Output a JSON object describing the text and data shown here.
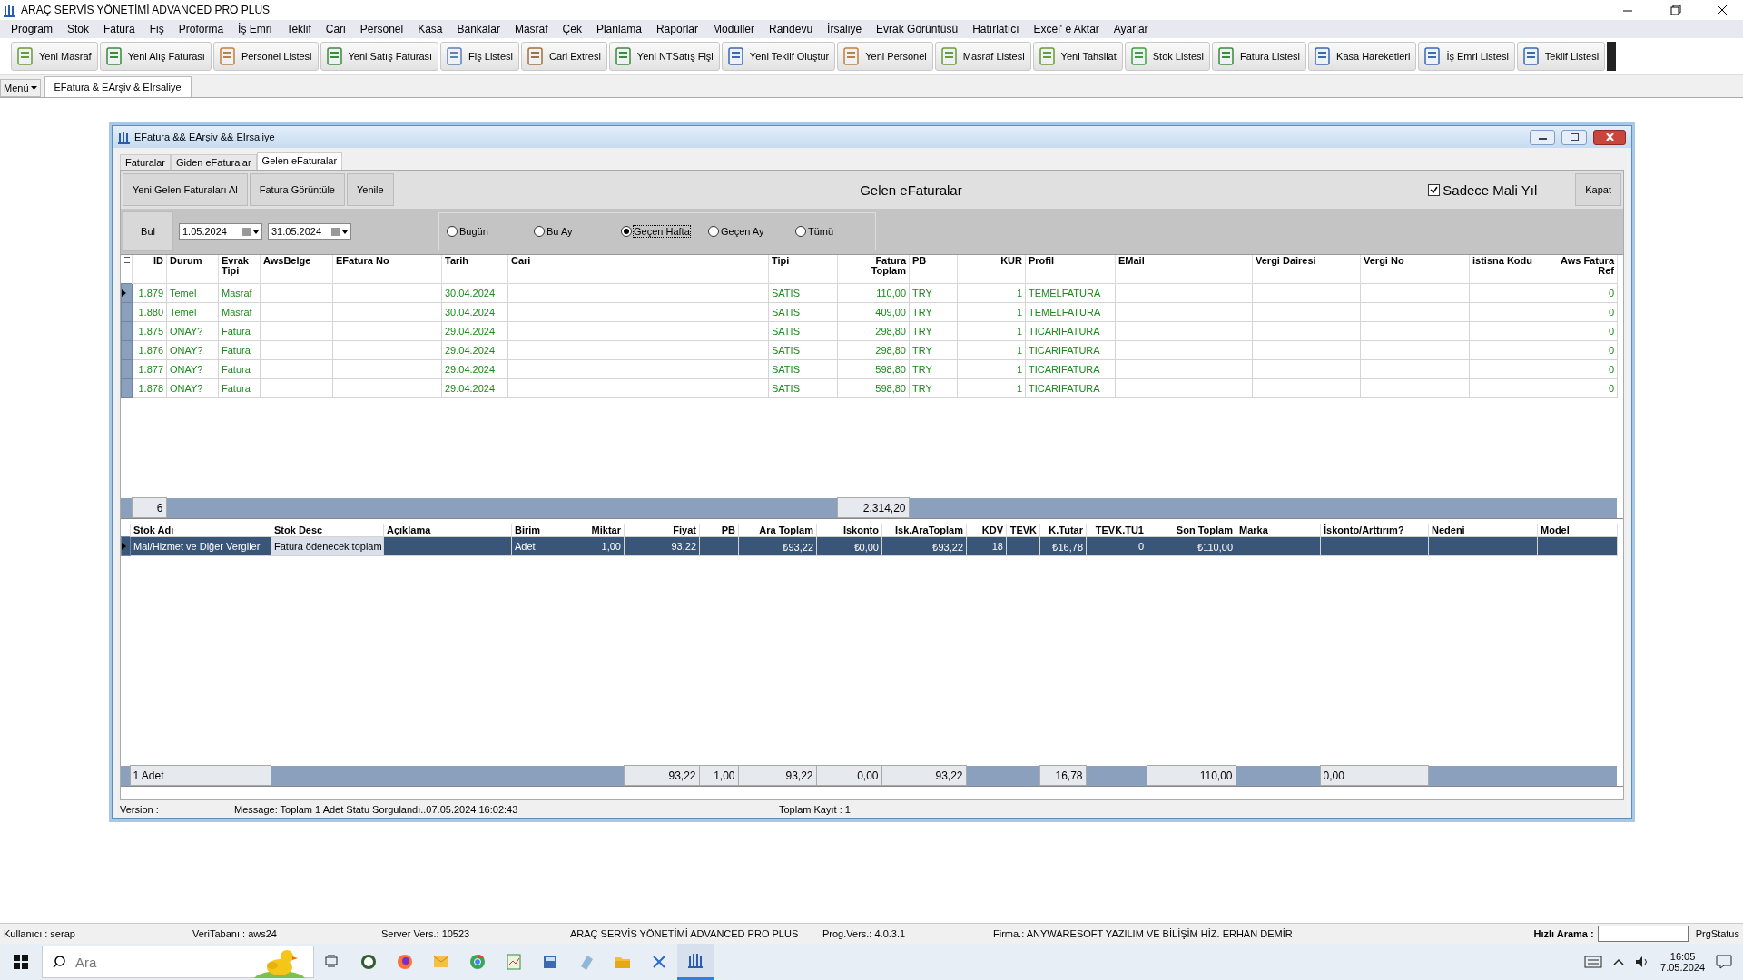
{
  "window": {
    "title": "ARAÇ SERVİS YÖNETİMİ ADVANCED PRO PLUS"
  },
  "menu": [
    "Program",
    "Stok",
    "Fatura",
    "Fiş",
    "Proforma",
    "İş Emri",
    "Teklif",
    "Cari",
    "Personel",
    "Kasa",
    "Bankalar",
    "Masraf",
    "Çek",
    "Planlama",
    "Raporlar",
    "Modüller",
    "Randevu",
    "İrsaliye",
    "Evrak Görüntüsü",
    "Hatırlatıcı",
    "Excel' e Aktar",
    "Ayarlar"
  ],
  "toolbar": [
    "Yeni Masraf",
    "Yeni Alış Faturası",
    "Personel Listesi",
    "Yeni Satış Faturası",
    "Fiş Listesi",
    "Cari Extresi",
    "Yeni NTSatış Fişi",
    "Yeni Teklif Oluştur",
    "Yeni Personel",
    "Masraf Listesi",
    "Yeni Tahsilat",
    "Stok Listesi",
    "Fatura Listesi",
    "Kasa Hareketleri",
    "İş Emri Listesi",
    "Teklif Listesi"
  ],
  "doc_tabs": {
    "menu_button": "Menü",
    "tabs": [
      {
        "label": "EFatura & EArşiv & EIrsaliye",
        "selected": true
      }
    ]
  },
  "child_window": {
    "title": "EFatura &&  EArşiv &&  EIrsaliye",
    "tabs": [
      {
        "label": "Faturalar",
        "selected": false
      },
      {
        "label": "Giden eFaturalar",
        "selected": false
      },
      {
        "label": "Gelen eFaturalar",
        "selected": true
      }
    ],
    "buttons": [
      "Yeni Gelen Faturaları Al",
      "Fatura Görüntüle",
      "Yenile"
    ],
    "heading": "Gelen eFaturalar",
    "fiscal_year": {
      "label": "Sadece Mali Yıl",
      "checked": true
    },
    "close_button": "Kapat",
    "find_button": "Bul",
    "date_from": "1.05.2024",
    "date_to": "31.05.2024",
    "periods": [
      {
        "label": "Bugün",
        "selected": false
      },
      {
        "label": "Bu Ay",
        "selected": false
      },
      {
        "label": "Geçen Hafta",
        "selected": true
      },
      {
        "label": "Geçen Ay",
        "selected": false
      },
      {
        "label": "Tümü",
        "selected": false
      }
    ],
    "invoices": {
      "columns": [
        {
          "label": "ID",
          "numeric": true,
          "footer": "6"
        },
        {
          "label": "Durum"
        },
        {
          "label": "Evrak Tipi"
        },
        {
          "label": "AwsBelge"
        },
        {
          "label": "EFatura No"
        },
        {
          "label": "Tarih"
        },
        {
          "label": "Cari"
        },
        {
          "label": "Tipi"
        },
        {
          "label": "Fatura Toplam",
          "numeric": true,
          "footer": "2.314,20"
        },
        {
          "label": "PB"
        },
        {
          "label": "KUR",
          "numeric": true
        },
        {
          "label": "Profil"
        },
        {
          "label": "EMail"
        },
        {
          "label": "Vergi Dairesi"
        },
        {
          "label": "Vergi No"
        },
        {
          "label": "istisna Kodu"
        },
        {
          "label": "Aws Fatura Ref",
          "numeric": true
        }
      ],
      "rows": [
        {
          "current": true,
          "cells": [
            "1.879",
            "Temel",
            "Masraf",
            "",
            "",
            "30.04.2024",
            "",
            "SATIS",
            "110,00",
            "TRY",
            "1",
            "TEMELFATURA",
            "",
            "",
            "",
            "",
            "0"
          ]
        },
        {
          "current": false,
          "cells": [
            "1.880",
            "Temel",
            "Masraf",
            "",
            "",
            "30.04.2024",
            "",
            "SATIS",
            "409,00",
            "TRY",
            "1",
            "TEMELFATURA",
            "",
            "",
            "",
            "",
            "0"
          ]
        },
        {
          "current": false,
          "cells": [
            "1.875",
            "ONAY?",
            "Fatura",
            "",
            "",
            "29.04.2024",
            "",
            "SATIS",
            "298,80",
            "TRY",
            "1",
            "TICARIFATURA",
            "",
            "",
            "",
            "",
            "0"
          ]
        },
        {
          "current": false,
          "cells": [
            "1.876",
            "ONAY?",
            "Fatura",
            "",
            "",
            "29.04.2024",
            "",
            "SATIS",
            "298,80",
            "TRY",
            "1",
            "TICARIFATURA",
            "",
            "",
            "",
            "",
            "0"
          ]
        },
        {
          "current": false,
          "cells": [
            "1.877",
            "ONAY?",
            "Fatura",
            "",
            "",
            "29.04.2024",
            "",
            "SATIS",
            "598,80",
            "TRY",
            "1",
            "TICARIFATURA",
            "",
            "",
            "",
            "",
            "0"
          ]
        },
        {
          "current": false,
          "cells": [
            "1.878",
            "ONAY?",
            "Fatura",
            "",
            "",
            "29.04.2024",
            "",
            "SATIS",
            "598,80",
            "TRY",
            "1",
            "TICARIFATURA",
            "",
            "",
            "",
            "",
            "0"
          ]
        }
      ]
    },
    "lines": {
      "columns": [
        {
          "label": "Stok Adı",
          "footer": "1 Adet"
        },
        {
          "label": "Stok Desc"
        },
        {
          "label": "Açıklama"
        },
        {
          "label": "Birim"
        },
        {
          "label": "Miktar",
          "numeric": true
        },
        {
          "label": "Fiyat",
          "numeric": true,
          "footer": "93,22"
        },
        {
          "label": "PB",
          "numeric": true,
          "footer": "1,00"
        },
        {
          "label": "Ara Toplam",
          "numeric": true,
          "footer": "93,22"
        },
        {
          "label": "Iskonto",
          "numeric": true,
          "footer": "0,00"
        },
        {
          "label": "Isk.AraToplam",
          "numeric": true,
          "footer": "93,22"
        },
        {
          "label": "KDV",
          "numeric": true
        },
        {
          "label": "TEVK",
          "numeric": true
        },
        {
          "label": "K.Tutar",
          "numeric": true,
          "footer": "16,78"
        },
        {
          "label": "TEVK.TU1",
          "numeric": true
        },
        {
          "label": "Son Toplam",
          "numeric": true,
          "footer": "110,00"
        },
        {
          "label": "Marka"
        },
        {
          "label": "İskonto/Arttırım?",
          "footer": "0,00"
        },
        {
          "label": "Nedeni"
        },
        {
          "label": "Model"
        }
      ],
      "rows": [
        {
          "selected": true,
          "cells": [
            "Mal/Hizmet ve Diğer Vergiler",
            "Fatura ödenecek toplam",
            "",
            "Adet",
            "1,00",
            "93,22",
            "",
            "₺93,22",
            "₺0,00",
            "₺93,22",
            "18",
            "",
            "₺16,78",
            "0",
            "₺110,00",
            "",
            "",
            "",
            ""
          ]
        }
      ]
    },
    "status": {
      "version": "Version :",
      "message": "Message:  Toplam 1 Adet Statu Sorgulandı..07.05.2024 16:02:43",
      "total": "Toplam Kayıt : 1"
    }
  },
  "status_bar": {
    "items": [
      "Kullanıcı : serap",
      "VeriTabanı : aws24",
      "Server Vers.: 10523",
      "ARAÇ SERVİS YÖNETİMİ ADVANCED PRO PLUS",
      "Prog.Vers.: 4.0.3.1",
      "Firma.: ANYWARESOFT YAZILIM VE BİLİŞİM HİZ. ERHAN DEMİR"
    ],
    "quick_search": "Hızlı Arama :",
    "prg_status": "PrgStatus"
  },
  "taskbar": {
    "search_placeholder": "Ara",
    "apps": [
      {
        "kind": "taskview"
      },
      {
        "kind": "hs"
      },
      {
        "kind": "firefox"
      },
      {
        "kind": "mail"
      },
      {
        "kind": "chrome"
      },
      {
        "kind": "sheet"
      },
      {
        "kind": "calc"
      },
      {
        "kind": "note"
      },
      {
        "kind": "folder"
      },
      {
        "kind": "tool"
      },
      {
        "kind": "aws",
        "selected": true
      }
    ],
    "time": "16:05",
    "date": "7.05.2024"
  }
}
